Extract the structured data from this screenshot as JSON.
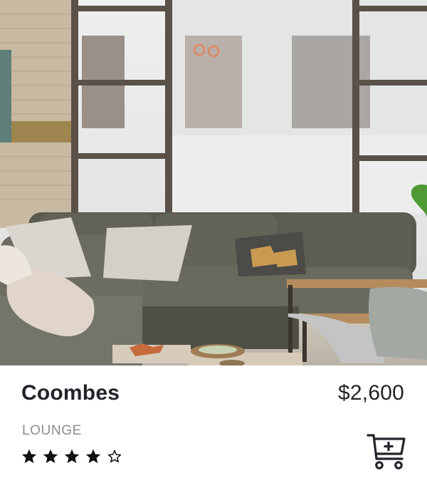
{
  "product": {
    "name": "Coombes",
    "price": "$2,600",
    "category": "LOUNGE",
    "rating": 4,
    "rating_max": 5
  },
  "icons": {
    "cart": "add-to-cart-icon",
    "star_filled": "star-filled-icon",
    "star_empty": "star-outline-icon"
  },
  "colors": {
    "text": "#23232b",
    "muted": "#8d8d93"
  }
}
